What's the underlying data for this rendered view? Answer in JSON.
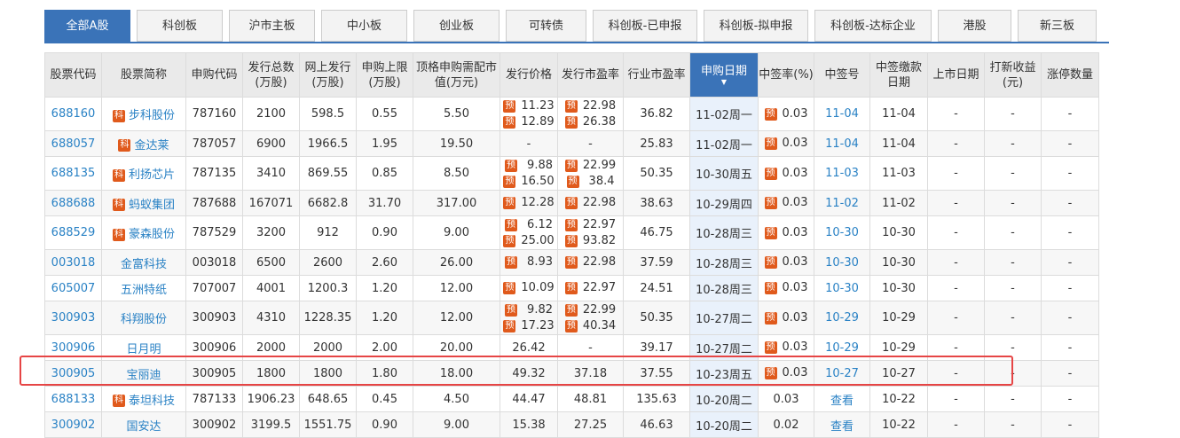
{
  "tabs": [
    "全部A股",
    "科创板",
    "沪市主板",
    "中小板",
    "创业板",
    "可转债",
    "科创板-已申报",
    "科创板-拟申报",
    "科创板-达标企业",
    "港股",
    "新三板"
  ],
  "badges": {
    "kechuang": "科",
    "yu": "预"
  },
  "headers": [
    "股票代码",
    "股票简称",
    "申购代码",
    "发行总数(万股)",
    "网上发行(万股)",
    "申购上限(万股)",
    "顶格申购需配市值(万元)",
    "发行价格",
    "发行市盈率",
    "行业市盈率",
    "申购日期",
    "中签率(%)",
    "中签号",
    "中签缴款日期",
    "上市日期",
    "打新收益(元)",
    "涨停数量"
  ],
  "rows": [
    {
      "code": "688160",
      "name": "步科股份",
      "sub": "787160",
      "total": "2100",
      "online": "598.5",
      "limit": "0.55",
      "cap": "5.50",
      "price": [
        "11.23",
        "12.89"
      ],
      "pe": [
        "22.98",
        "26.38"
      ],
      "ipe": "36.82",
      "date": "11-02周一",
      "rate": "0.03",
      "no": "11-04",
      "pay": "11-04",
      "list": "-",
      "profit": "-",
      "zt": "-"
    },
    {
      "code": "688057",
      "name": "金达莱",
      "sub": "787057",
      "total": "6900",
      "online": "1966.5",
      "limit": "1.95",
      "cap": "19.50",
      "price": "-",
      "pe": "-",
      "ipe": "25.83",
      "date": "11-02周一",
      "rate": "0.03",
      "no": "11-04",
      "pay": "11-04",
      "list": "-",
      "profit": "-",
      "zt": "-"
    },
    {
      "code": "688135",
      "name": "利扬芯片",
      "sub": "787135",
      "total": "3410",
      "online": "869.55",
      "limit": "0.85",
      "cap": "8.50",
      "price": [
        "9.88",
        "16.50"
      ],
      "pe": [
        "22.99",
        "38.4"
      ],
      "ipe": "50.35",
      "date": "10-30周五",
      "rate": "0.03",
      "no": "11-03",
      "pay": "11-03",
      "list": "-",
      "profit": "-",
      "zt": "-"
    },
    {
      "code": "688688",
      "name": "蚂蚁集团",
      "sub": "787688",
      "total": "167071",
      "online": "6682.8",
      "limit": "31.70",
      "cap": "317.00",
      "price": [
        "12.28"
      ],
      "pe": [
        "22.98"
      ],
      "ipe": "38.63",
      "date": "10-29周四",
      "rate": "0.03",
      "no": "11-02",
      "pay": "11-02",
      "list": "-",
      "profit": "-",
      "zt": "-"
    },
    {
      "code": "688529",
      "name": "豪森股份",
      "sub": "787529",
      "total": "3200",
      "online": "912",
      "limit": "0.90",
      "cap": "9.00",
      "price": [
        "6.12",
        "25.00"
      ],
      "pe": [
        "22.97",
        "93.82"
      ],
      "ipe": "46.75",
      "date": "10-28周三",
      "rate": "0.03",
      "no": "10-30",
      "pay": "10-30",
      "list": "-",
      "profit": "-",
      "zt": "-"
    },
    {
      "code": "003018",
      "name": "金富科技",
      "sub": "003018",
      "total": "6500",
      "online": "2600",
      "limit": "2.60",
      "cap": "26.00",
      "price": [
        "8.93"
      ],
      "pe": [
        "22.98"
      ],
      "ipe": "37.59",
      "date": "10-28周三",
      "rate": "0.03",
      "no": "10-30",
      "pay": "10-30",
      "list": "-",
      "profit": "-",
      "zt": "-"
    },
    {
      "code": "605007",
      "name": "五洲特纸",
      "sub": "707007",
      "total": "4001",
      "online": "1200.3",
      "limit": "1.20",
      "cap": "12.00",
      "price": [
        "10.09"
      ],
      "pe": [
        "22.97"
      ],
      "ipe": "24.51",
      "date": "10-28周三",
      "rate": "0.03",
      "no": "10-30",
      "pay": "10-30",
      "list": "-",
      "profit": "-",
      "zt": "-"
    },
    {
      "code": "300903",
      "name": "科翔股份",
      "sub": "300903",
      "total": "4310",
      "online": "1228.35",
      "limit": "1.20",
      "cap": "12.00",
      "price": [
        "9.82",
        "17.23"
      ],
      "pe": [
        "22.99",
        "40.34"
      ],
      "ipe": "50.35",
      "date": "10-27周二",
      "rate": "0.03",
      "no": "10-29",
      "pay": "10-29",
      "list": "-",
      "profit": "-",
      "zt": "-"
    },
    {
      "code": "300906",
      "name": "日月明",
      "sub": "300906",
      "total": "2000",
      "online": "2000",
      "limit": "2.00",
      "cap": "20.00",
      "price": "26.42",
      "pe": "-",
      "ipe": "39.17",
      "date": "10-27周二",
      "rate": "0.03",
      "no": "10-29",
      "pay": "10-29",
      "list": "-",
      "profit": "-",
      "zt": "-"
    },
    {
      "code": "300905",
      "name": "宝丽迪",
      "sub": "300905",
      "total": "1800",
      "online": "1800",
      "limit": "1.80",
      "cap": "18.00",
      "price": "49.32",
      "pe": "37.18",
      "ipe": "37.55",
      "date": "10-23周五",
      "rate": "0.03",
      "no": "10-27",
      "pay": "10-27",
      "list": "-",
      "profit": "-",
      "zt": "-"
    },
    {
      "code": "688133",
      "name": "泰坦科技",
      "sub": "787133",
      "total": "1906.23",
      "online": "648.65",
      "limit": "0.45",
      "cap": "4.50",
      "price": "44.47",
      "pe": "48.81",
      "ipe": "135.63",
      "date": "10-20周二",
      "rate": "0.03",
      "no": "查看",
      "pay": "10-22",
      "list": "-",
      "profit": "-",
      "zt": "-"
    },
    {
      "code": "300902",
      "name": "国安达",
      "sub": "300902",
      "total": "3199.5",
      "online": "1551.75",
      "limit": "0.90",
      "cap": "9.00",
      "price": "15.38",
      "pe": "27.25",
      "ipe": "46.63",
      "date": "10-20周二",
      "rate": "0.02",
      "no": "查看",
      "pay": "10-22",
      "list": "-",
      "profit": "-",
      "zt": "-"
    }
  ],
  "kechuang_rows": [
    0,
    1,
    2,
    3,
    4,
    10
  ],
  "yu_rate_rows": [
    0,
    1,
    2,
    3,
    4,
    5,
    6,
    7,
    8,
    9
  ],
  "sorted_column": 10,
  "highlight_row": 9,
  "colors": {
    "accent": "#3a73b8",
    "link": "#2a82c5",
    "badge": "#e05a1c",
    "highlight": "#e64545"
  }
}
